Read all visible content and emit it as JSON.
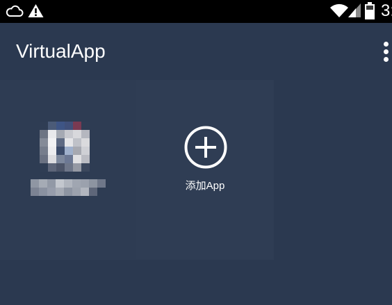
{
  "status_bar": {
    "time": "3:",
    "icons": [
      "cloud-icon",
      "warning-icon",
      "wifi-icon",
      "signal-icon",
      "battery-icon"
    ]
  },
  "app_bar": {
    "title": "VirtualApp",
    "menu_icon": "more-vert-icon"
  },
  "tiles": [
    {
      "type": "installed-app",
      "label": "",
      "icon": "app-icon"
    },
    {
      "type": "add-app",
      "label": "添加App",
      "icon": "plus-circle-icon"
    }
  ],
  "colors": {
    "background": "#2b3950",
    "tile": "#2e3c53",
    "status_bar": "#000000",
    "foreground": "#ffffff"
  }
}
